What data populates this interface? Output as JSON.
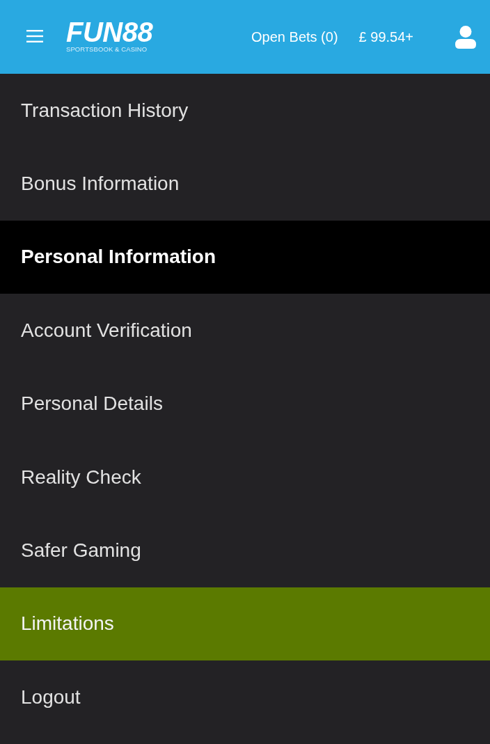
{
  "header": {
    "logo": {
      "name": "FUN88",
      "tagline": "SPORTSBOOK & CASINO"
    },
    "open_bets": "Open Bets (0)",
    "balance": "£ 99.54+"
  },
  "menu": {
    "items": [
      {
        "label": "Transaction History",
        "kind": "link",
        "selected": false
      },
      {
        "label": "Bonus Information",
        "kind": "link",
        "selected": false
      },
      {
        "label": "Personal Information",
        "kind": "heading",
        "selected": false
      },
      {
        "label": "Account Verification",
        "kind": "link",
        "selected": false
      },
      {
        "label": "Personal Details",
        "kind": "link",
        "selected": false
      },
      {
        "label": "Reality Check",
        "kind": "link",
        "selected": false
      },
      {
        "label": "Safer Gaming",
        "kind": "link",
        "selected": false
      },
      {
        "label": "Limitations",
        "kind": "link",
        "selected": true
      },
      {
        "label": "Logout",
        "kind": "link",
        "selected": false
      }
    ]
  }
}
